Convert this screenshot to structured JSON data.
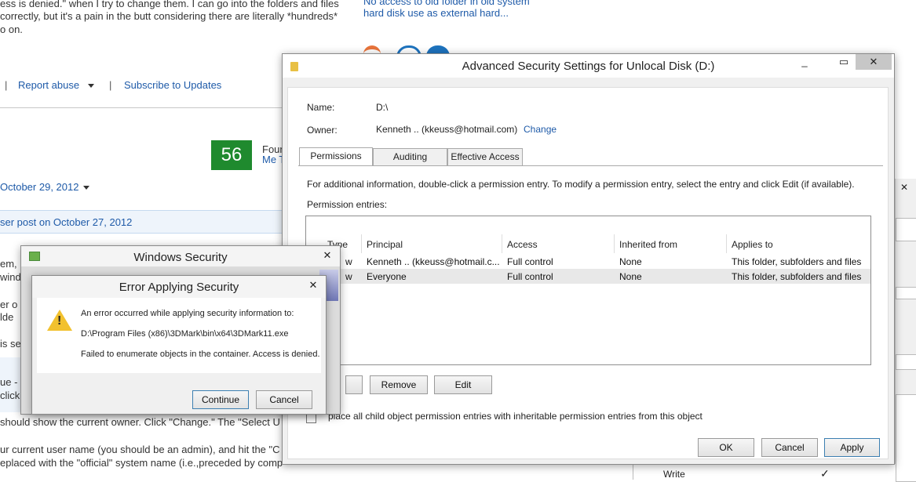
{
  "forum": {
    "top_text_1": "ess is denied.\" when I try to change them. I can go into the folders and files",
    "top_text_2": "correctly, but it's a pain in the butt considering there are literally *hundreds*",
    "top_text_3": "o on.",
    "related_1": "No access to old folder in old system",
    "related_2": "hard disk use as external hard...",
    "report_abuse": "Report abuse",
    "subscribe": "Subscribe to Updates",
    "vote_count": "56",
    "found_1": "Foun",
    "found_2": "Me T",
    "date_1": "October 29, 2012",
    "reply_to": "ser post on October 27, 2012",
    "side_1": "em,",
    "side_2": "wind",
    "side_3": "er o",
    "side_4": "lde",
    "side_5": "is se",
    "side_6": "ue -",
    "side_7": "click, se",
    "line_owner": "should show the current owner. Click \"Change.\" The \"Select U",
    "line_user": "ur current user name (you should be an admin), and hit the \"C",
    "line_placed": "eplaced with the \"official\" system name (i.e.,preceded by comp",
    "perm_write": "Write",
    "checkmark": "✓"
  },
  "adv": {
    "title": "Advanced Security Settings for Unlocal Disk (D:)",
    "name_label": "Name:",
    "name_value": "D:\\",
    "owner_label": "Owner:",
    "owner_value": "Kenneth .. (kkeuss@hotmail.com)",
    "change": "Change",
    "tabs": [
      "Permissions",
      "Auditing",
      "Effective Access"
    ],
    "info": "For additional information, double-click a permission entry. To modify a permission entry, select the entry and click Edit (if available).",
    "entries_label": "Permission entries:",
    "columns": [
      "Type",
      "Principal",
      "Access",
      "Inherited from",
      "Applies to"
    ],
    "rows": [
      {
        "type": "w",
        "principal": "Kenneth .. (kkeuss@hotmail.c...",
        "access": "Full control",
        "inherited": "None",
        "applies": "This folder, subfolders and files"
      },
      {
        "type": "w",
        "principal": "Everyone",
        "access": "Full control",
        "inherited": "None",
        "applies": "This folder, subfolders and files"
      }
    ],
    "remove": "Remove",
    "edit": "Edit",
    "replace_text": "place all child object permission entries with inheritable permission entries from this object",
    "ok": "OK",
    "cancel": "Cancel",
    "apply": "Apply",
    "minimize": "▭",
    "close": "✕"
  },
  "winsec": {
    "title": "Windows Security",
    "close": "✕"
  },
  "err": {
    "title": "Error Applying Security",
    "line1": "An error occurred while applying security information to:",
    "line2": "D:\\Program Files (x86)\\3DMark\\bin\\x64\\3DMark11.exe",
    "line3": "Failed to enumerate objects in the container. Access is denied.",
    "continue": "Continue",
    "cancel": "Cancel",
    "close": "✕"
  }
}
